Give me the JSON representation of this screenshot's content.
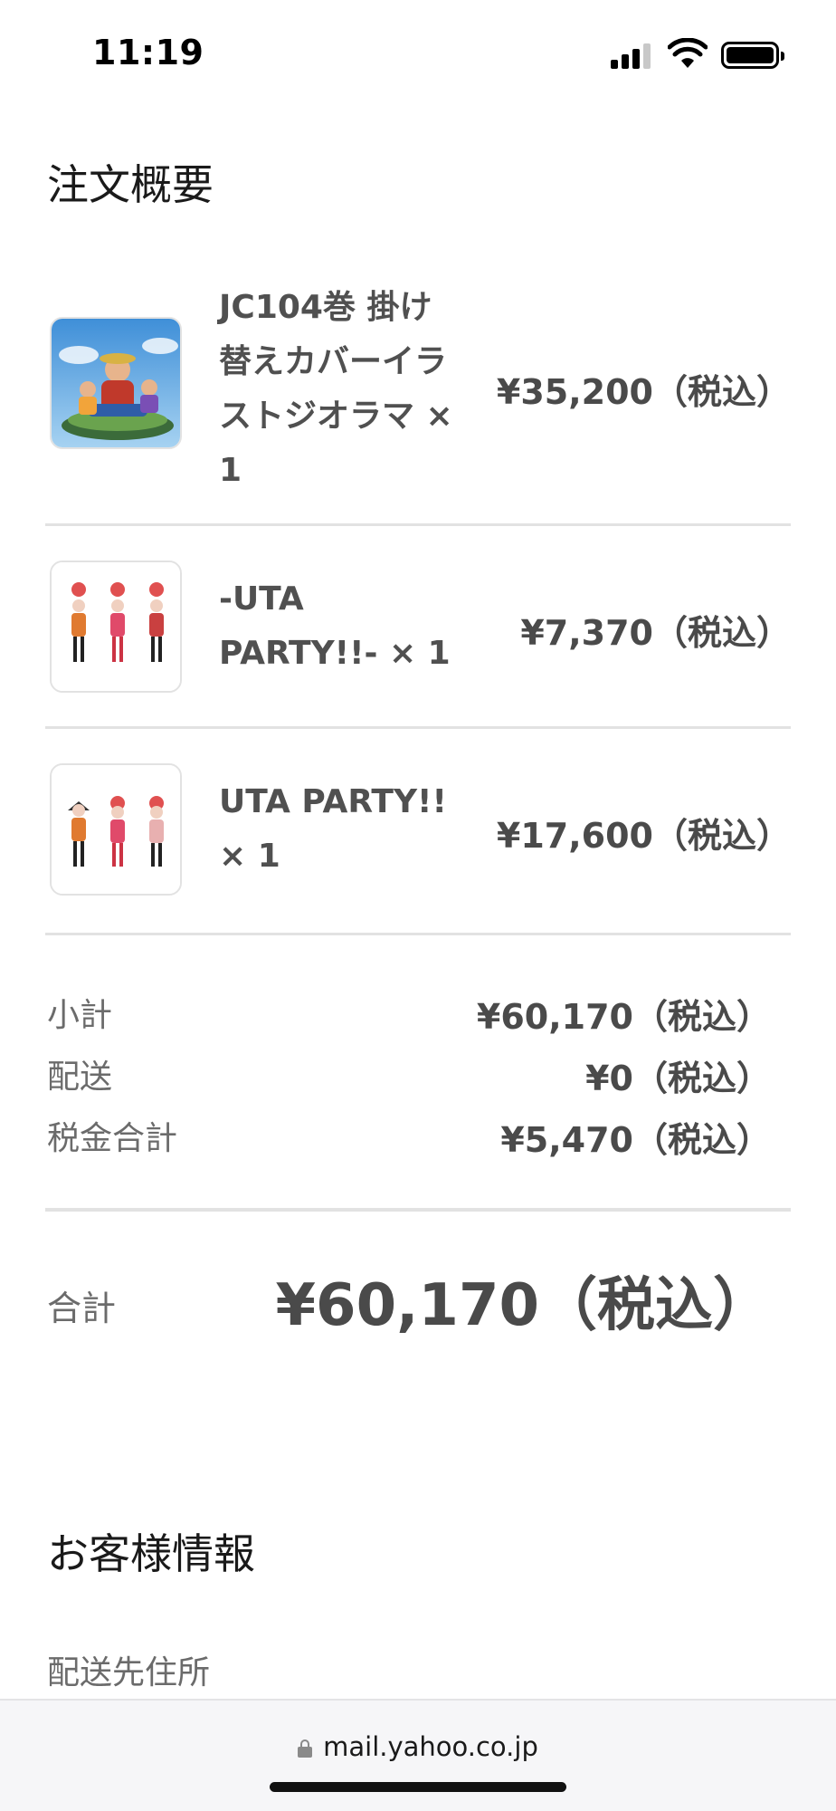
{
  "status_bar": {
    "time": "11:19"
  },
  "order_summary": {
    "title": "注文概要",
    "items": [
      {
        "name": "JC104巻 掛け替えカバーイラストジオラマ × 1",
        "price": "¥35,200（税込）",
        "thumbnail_icon": "one-piece-diorama-figure"
      },
      {
        "name": "-UTA PARTY!!- × 1",
        "price": "¥7,370（税込）",
        "thumbnail_icon": "uta-figures"
      },
      {
        "name": "UTA PARTY!! × 1",
        "price": "¥17,600（税込）",
        "thumbnail_icon": "uta-figures"
      }
    ],
    "subtotal": {
      "label": "小計",
      "value": "¥60,170（税込）"
    },
    "shipping": {
      "label": "配送",
      "value": "¥0（税込）"
    },
    "tax": {
      "label": "税金合計",
      "value": "¥5,470（税込）"
    },
    "total": {
      "label": "合計",
      "value": "¥60,170（税込）"
    }
  },
  "customer_info": {
    "title": "お客様情報",
    "shipping_address_label": "配送先住所"
  },
  "browser": {
    "url": "mail.yahoo.co.jp"
  }
}
